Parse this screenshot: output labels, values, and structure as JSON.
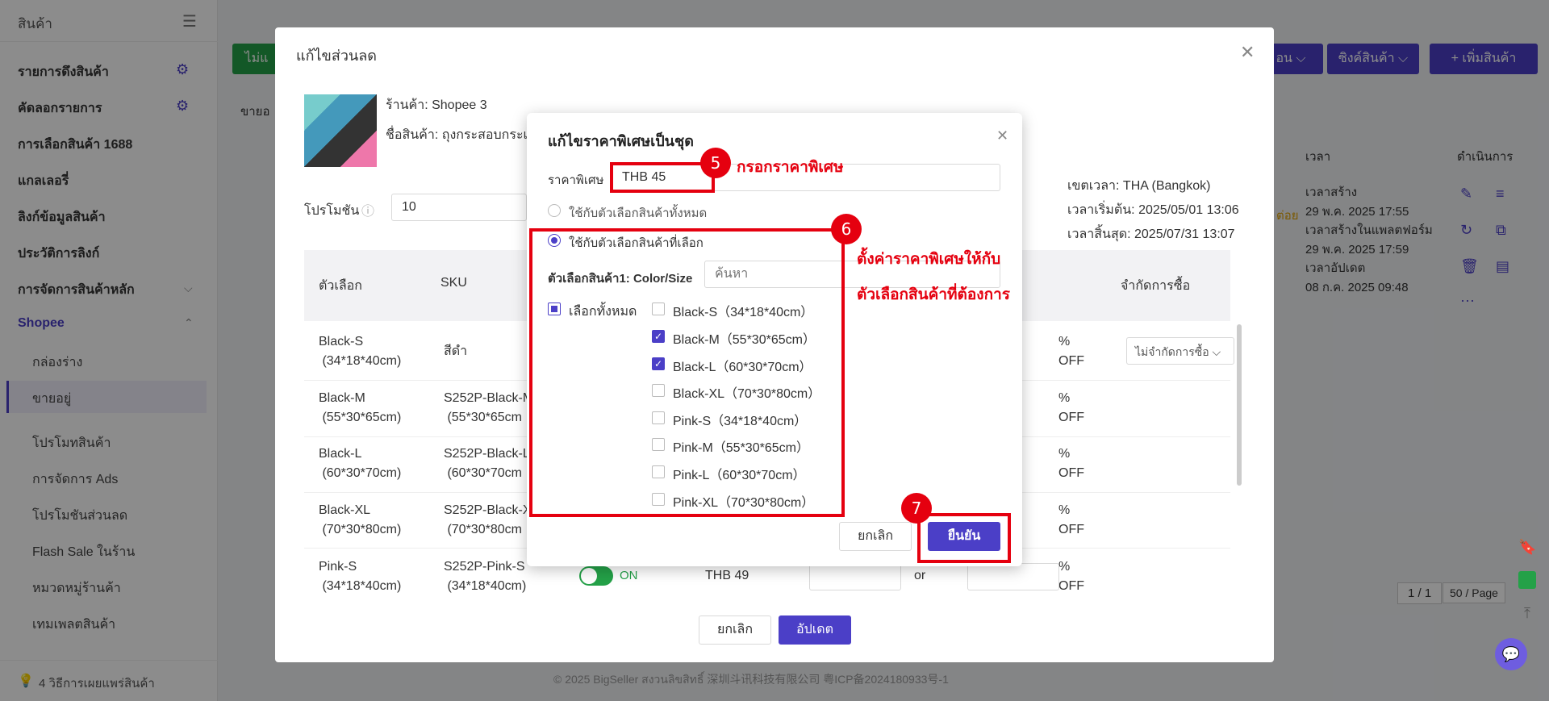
{
  "sidebar": {
    "title": "สินค้า",
    "items": [
      {
        "label": "รายการดึงสินค้า"
      },
      {
        "label": "คัดลอกรายการ"
      },
      {
        "label": "การเลือกสินค้า 1688"
      },
      {
        "label": "แกลเลอรี่"
      },
      {
        "label": "ลิงก์ข้อมูลสินค้า"
      },
      {
        "label": "ประวัติการลิงก์"
      },
      {
        "label": "การจัดการสินค้าหลัก"
      },
      {
        "label": "Shopee"
      }
    ],
    "sub_items": [
      {
        "label": "กล่องร่าง"
      },
      {
        "label": "ขายอยู่"
      },
      {
        "label": "โปรโมทสินค้า"
      },
      {
        "label": "การจัดการ Ads"
      },
      {
        "label": "โปรโมชันส่วนลด"
      },
      {
        "label": "Flash Sale ในร้าน"
      },
      {
        "label": "หมวดหมู่ร้านค้า"
      },
      {
        "label": "เทมเพลตสินค้า"
      }
    ],
    "footer": "4 วิธีการเผยแพร่สินค้า"
  },
  "background": {
    "buttons": [
      {
        "label": "ไม่แ"
      },
      {
        "label": "อน ⌵"
      },
      {
        "label": "ซิงค์สินค้า ⌵"
      },
      {
        "label": "+ เพิ่มสินค้า"
      }
    ],
    "tab_label": "ขายอ",
    "col_time": "เวลา",
    "col_action": "ดำเนินการ",
    "times": [
      "เวลาสร้าง",
      "29 พ.ค. 2025 17:55",
      "เวลาสร้างในแพลตฟอร์ม",
      "29 พ.ค. 2025 17:59",
      "เวลาอัปเดต",
      "08 ก.ค. 2025 09:48"
    ],
    "status_fragment": "ต่อย",
    "pagination": {
      "page": "1 / 1",
      "per_page": "50 / Page"
    },
    "footer": "© 2025 BigSeller สงวนลิขสิทธิ์  深圳斗讯科技有限公司  粤ICP备2024180933号-1"
  },
  "modal": {
    "title": "แก้ไขส่วนลด",
    "shop": "ร้านค้า: Shopee 3",
    "product": "ชื่อสินค้า: ถุงกระสอบกระเป๋",
    "promotion_label": "โปรโมชัน",
    "promotion_value": "10",
    "timezone": "เขตเวลา:  THA (Bangkok)",
    "start": "เวลาเริ่มต้น:   2025/05/01 13:06",
    "end": "เวลาสิ้นสุด:   2025/07/31 13:07",
    "columns": {
      "option": "ตัวเลือก",
      "sku": "SKU",
      "limit": "จำกัดการซื้อ"
    },
    "rows": [
      {
        "option": "Black-S\n (34*18*40cm)",
        "sku": "สีดำ"
      },
      {
        "option": "Black-M\n (55*30*65cm)",
        "sku": "S252P-Black-M\n (55*30*65cm"
      },
      {
        "option": "Black-L\n (60*30*70cm)",
        "sku": "S252P-Black-L\n (60*30*70cm"
      },
      {
        "option": "Black-XL\n (70*30*80cm)",
        "sku": "S252P-Black-X\n (70*30*80cm"
      },
      {
        "option": "Pink-S\n (34*18*40cm)",
        "sku": "S252P-Pink-S\n (34*18*40cm)"
      }
    ],
    "pct": "%\nOFF",
    "limit_select": "ไม่จำกัดการซื้อ ⌵",
    "toggle_label": "ON",
    "price": "THB 49",
    "or_text": "or",
    "cancel": "ยกเลิก",
    "update": "อัปเดต"
  },
  "dialog": {
    "title": "แก้ไขราคาพิเศษเป็นชุด",
    "price_label": "ราคาพิเศษ",
    "price_value": "THB  45",
    "radio_all": "ใช้กับตัวเลือกสินค้าทั้งหมด",
    "radio_selected": "ใช้กับตัวเลือกสินค้าที่เลือก",
    "variant_label": "ตัวเลือกสินค้า1: Color/Size",
    "search_placeholder": "ค้นหา",
    "select_all": "เลือกทั้งหมด",
    "options": [
      {
        "label": "Black-S（34*18*40cm）",
        "checked": false
      },
      {
        "label": "Black-M（55*30*65cm）",
        "checked": true
      },
      {
        "label": "Black-L（60*30*70cm）",
        "checked": true
      },
      {
        "label": "Black-XL（70*30*80cm）",
        "checked": false
      },
      {
        "label": "Pink-S（34*18*40cm）",
        "checked": false
      },
      {
        "label": "Pink-M（55*30*65cm）",
        "checked": false
      },
      {
        "label": "Pink-L（60*30*70cm）",
        "checked": false
      },
      {
        "label": "Pink-XL（70*30*80cm）",
        "checked": false
      }
    ],
    "cancel": "ยกเลิก",
    "confirm": "ยืนยัน"
  },
  "annotations": {
    "step5": "5",
    "step5_text": "กรอกราคาพิเศษ",
    "step6": "6",
    "step6_text1": "ตั้งค่าราคาพิเศษให้กับ",
    "step6_text2": "ตัวเลือกสินค้าที่ต้องการ",
    "step7": "7",
    "red": "#e5000f"
  },
  "colors": {
    "accent": "#4b3fc7"
  }
}
